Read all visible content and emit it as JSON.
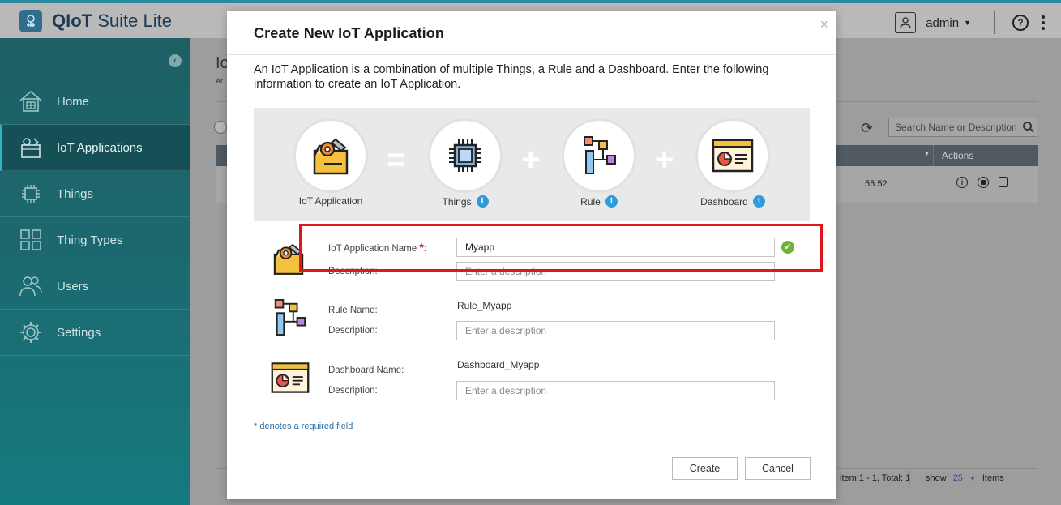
{
  "app": {
    "title_bold": "QIoT",
    "title_rest": " Suite Lite",
    "user": "admin"
  },
  "sidebar": {
    "items": [
      {
        "label": "Home",
        "icon": "home-icon"
      },
      {
        "label": "IoT Applications",
        "icon": "iot-applications-icon",
        "active": true
      },
      {
        "label": "Things",
        "icon": "chip-icon"
      },
      {
        "label": "Thing Types",
        "icon": "thing-types-icon"
      },
      {
        "label": "Users",
        "icon": "users-icon"
      },
      {
        "label": "Settings",
        "icon": "gear-icon"
      }
    ]
  },
  "main": {
    "title": "Io",
    "subtitle": "Ar",
    "search_placeholder": "Search Name or Description",
    "actions_header": "Actions",
    "row_time": ":55:52",
    "pagination": "item:1 - 1, Total: 1",
    "show_label": "show",
    "show_count": "25",
    "items_label": "Items"
  },
  "modal": {
    "title": "Create New IoT Application",
    "intro": "An IoT Application is a combination of multiple Things, a Rule and a Dashboard. Enter the following information to create an IoT Application.",
    "formula": {
      "iot_app_label": "IoT Application",
      "equals": "=",
      "things_label": "Things",
      "plus": "+",
      "rule_label": "Rule",
      "dashboard_label": "Dashboard"
    },
    "app_section": {
      "name_label": "IoT Application Name",
      "required_mark": "*",
      "colon": ":",
      "name_value": "Myapp",
      "desc_label": "Description:",
      "desc_placeholder": "Enter a description"
    },
    "rule_section": {
      "name_label": "Rule Name:",
      "name_value": "Rule_Myapp",
      "desc_label": "Description:",
      "desc_placeholder": "Enter a description"
    },
    "dashboard_section": {
      "name_label": "Dashboard Name:",
      "name_value": "Dashboard_Myapp",
      "desc_label": "Description:",
      "desc_placeholder": "Enter a description"
    },
    "required_note": "* denotes a required field",
    "create_label": "Create",
    "cancel_label": "Cancel",
    "close_glyph": "×"
  },
  "colors": {
    "accent": "#2e9bdc",
    "highlight": "#e11717",
    "success": "#6fb23a",
    "sidebar": "#1b6a70"
  }
}
